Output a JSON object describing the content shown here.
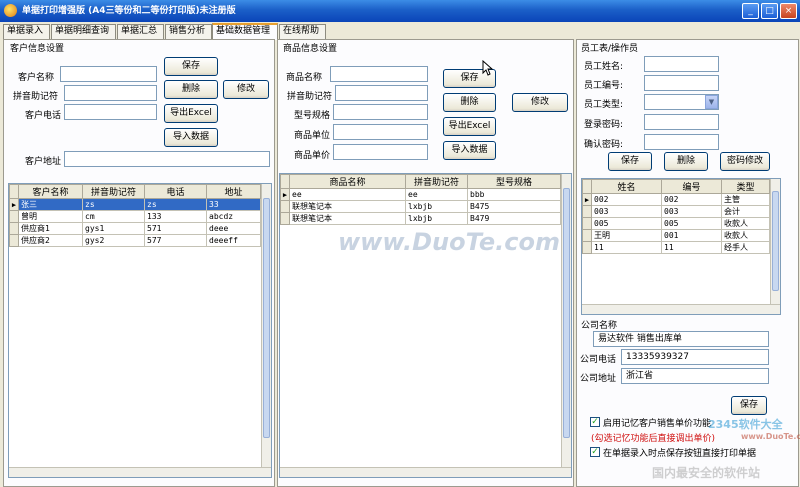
{
  "window": {
    "title": "单据打印增强版 (A4三等份和二等份打印版)未注册版",
    "minimize": "_",
    "maximize": "□",
    "close": "×"
  },
  "tabs": [
    "单据录入",
    "单据明细查询",
    "单据汇总",
    "销售分析",
    "基础数据管理",
    "在线帮助"
  ],
  "customer": {
    "section_title": "客户信息设置",
    "labels": {
      "name": "客户名称",
      "pinyin": "拼音助记符",
      "phone": "客户电话",
      "address": "客户地址"
    },
    "buttons": {
      "save": "保存",
      "delete": "删除",
      "modify": "修改",
      "export": "导出Excel",
      "import": "导入数据"
    },
    "columns": [
      "客户名称",
      "拼音助记符",
      "电话",
      "地址"
    ],
    "rows": [
      [
        "张三",
        "zs",
        "zs",
        "33"
      ],
      [
        "曾明",
        "cm",
        "133",
        "abcdz"
      ],
      [
        "供应商1",
        "gys1",
        "571",
        "deee"
      ],
      [
        "供应商2",
        "gys2",
        "577",
        "deeeff"
      ]
    ]
  },
  "product": {
    "section_title": "商品信息设置",
    "labels": {
      "name": "商品名称",
      "pinyin": "拼音助记符",
      "model": "型号规格",
      "unit": "商品单位",
      "price": "商品单价"
    },
    "buttons": {
      "save": "保存",
      "delete": "删除",
      "modify": "修改",
      "export": "导出Excel",
      "import": "导入数据"
    },
    "columns": [
      "商品名称",
      "拼音助记符",
      "型号规格"
    ],
    "rows": [
      [
        "ee",
        "ee",
        "bbb"
      ],
      [
        "联想笔记本",
        "lxbjb",
        "B475"
      ],
      [
        "联想笔记本",
        "lxbjb",
        "B479"
      ]
    ]
  },
  "employee": {
    "section_title": "员工表/操作员",
    "labels": {
      "name": "员工姓名:",
      "id": "员工编号:",
      "type": "员工类型:",
      "password": "登录密码:",
      "confirm": "确认密码:"
    },
    "buttons": {
      "save": "保存",
      "delete": "删除",
      "change_password": "密码修改"
    },
    "columns": [
      "姓名",
      "编号",
      "类型"
    ],
    "rows": [
      [
        "002",
        "002",
        "主管"
      ],
      [
        "003",
        "003",
        "会计"
      ],
      [
        "005",
        "005",
        "收款人"
      ],
      [
        "王明",
        "001",
        "收款人"
      ],
      [
        "11",
        "11",
        "经手人"
      ]
    ]
  },
  "company": {
    "name_label": "公司名称",
    "name_value": "易达软件 销售出库单",
    "phone_label": "公司电话",
    "phone_value": "13335939327",
    "address_label": "公司地址",
    "address_value": "浙江省",
    "save": "保存"
  },
  "options": {
    "remember": "启用记忆客户销售单价功能",
    "remember_note": "(勾选记忆功能后直接调出单价)",
    "print_on_save": "在单据录入时点保存按钮直接打印单据"
  },
  "watermarks": {
    "center": "www.DuoTe.com",
    "brand": "2345软件大全",
    "brand_url": "www.DuoTe.com",
    "footer": "国内最安全的软件站"
  },
  "colors": {
    "titlebar": "#1b5fc8",
    "selection": "#316ac5",
    "panel": "#fcfcfe",
    "chrome": "#ece9d8",
    "note_red": "#d01010"
  }
}
